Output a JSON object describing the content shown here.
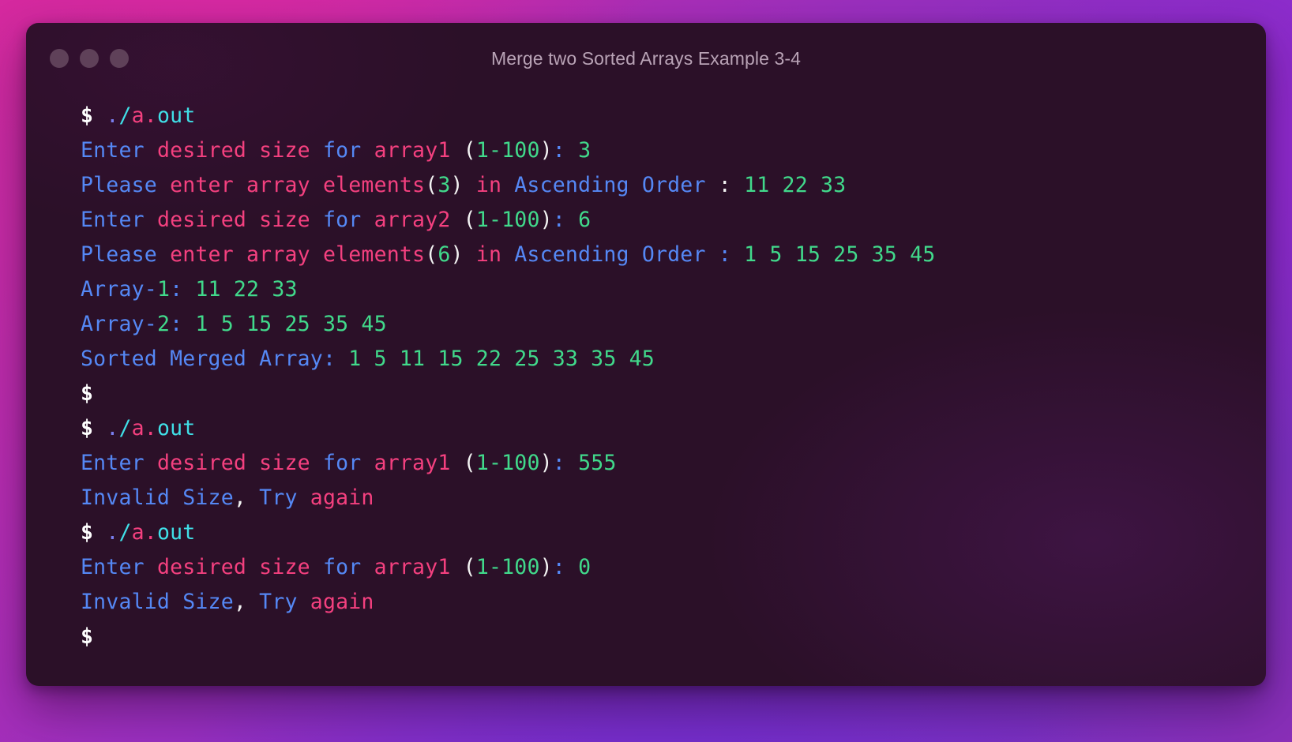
{
  "window": {
    "title": "Merge two Sorted Arrays Example 3-4",
    "dots": [
      "close-dot",
      "minimize-dot",
      "maximize-dot"
    ],
    "dot_color": "#5f4159",
    "background_color": "#2b1028"
  },
  "palette": {
    "prompt_white": "#ffffff",
    "pink": "#f4407f",
    "cyan": "#40e0e8",
    "blue": "#5588f5",
    "green": "#41d98b",
    "dot_purple": "#7a7ff0",
    "title_gray": "#b9a3b6",
    "desktop_gradient_from": "#d02a9e",
    "desktop_gradient_to": "#7c2fc6"
  },
  "terminal": {
    "prompt_symbol": "$",
    "command": "./a.out",
    "lines": [
      {
        "id": "line-1-command-1",
        "type": "command",
        "segments": [
          {
            "text": "$",
            "color": "prompt"
          },
          {
            "text": " ",
            "color": "white"
          },
          {
            "text": ".",
            "color": "dot"
          },
          {
            "text": "/",
            "color": "cyan"
          },
          {
            "text": "a",
            "color": "pink"
          },
          {
            "text": ".",
            "color": "pink"
          },
          {
            "text": "out",
            "color": "cyan"
          }
        ]
      },
      {
        "id": "line-2-prompt-size-array1",
        "type": "output",
        "segments": [
          {
            "text": "Enter",
            "color": "blue"
          },
          {
            "text": " ",
            "color": "white"
          },
          {
            "text": "desired size",
            "color": "pink"
          },
          {
            "text": " ",
            "color": "white"
          },
          {
            "text": "for",
            "color": "blue"
          },
          {
            "text": " ",
            "color": "white"
          },
          {
            "text": "array1",
            "color": "pink"
          },
          {
            "text": " ",
            "color": "white"
          },
          {
            "text": "(",
            "color": "white"
          },
          {
            "text": "1-100",
            "color": "green"
          },
          {
            "text": ")",
            "color": "white"
          },
          {
            "text": ":",
            "color": "blue"
          },
          {
            "text": " ",
            "color": "white"
          },
          {
            "text": "3",
            "color": "green"
          }
        ]
      },
      {
        "id": "line-3-enter-elements-3",
        "type": "output",
        "segments": [
          {
            "text": "Please",
            "color": "blue"
          },
          {
            "text": " ",
            "color": "white"
          },
          {
            "text": "enter array elements",
            "color": "pink"
          },
          {
            "text": "(",
            "color": "white"
          },
          {
            "text": "3",
            "color": "green"
          },
          {
            "text": ")",
            "color": "white"
          },
          {
            "text": " ",
            "color": "white"
          },
          {
            "text": "in",
            "color": "pink"
          },
          {
            "text": " ",
            "color": "white"
          },
          {
            "text": "Ascending Order",
            "color": "blue"
          },
          {
            "text": " ",
            "color": "white"
          },
          {
            "text": ":",
            "color": "white"
          },
          {
            "text": " ",
            "color": "white"
          },
          {
            "text": "11 22 33",
            "color": "green"
          }
        ]
      },
      {
        "id": "line-4-prompt-size-array2",
        "type": "output",
        "segments": [
          {
            "text": "Enter",
            "color": "blue"
          },
          {
            "text": " ",
            "color": "white"
          },
          {
            "text": "desired size",
            "color": "pink"
          },
          {
            "text": " ",
            "color": "white"
          },
          {
            "text": "for",
            "color": "blue"
          },
          {
            "text": " ",
            "color": "white"
          },
          {
            "text": "array2",
            "color": "pink"
          },
          {
            "text": " ",
            "color": "white"
          },
          {
            "text": "(",
            "color": "white"
          },
          {
            "text": "1-100",
            "color": "green"
          },
          {
            "text": ")",
            "color": "white"
          },
          {
            "text": ":",
            "color": "blue"
          },
          {
            "text": " ",
            "color": "white"
          },
          {
            "text": "6",
            "color": "green"
          }
        ]
      },
      {
        "id": "line-5-enter-elements-6",
        "type": "output",
        "segments": [
          {
            "text": "Please",
            "color": "blue"
          },
          {
            "text": " ",
            "color": "white"
          },
          {
            "text": "enter array elements",
            "color": "pink"
          },
          {
            "text": "(",
            "color": "white"
          },
          {
            "text": "6",
            "color": "green"
          },
          {
            "text": ")",
            "color": "white"
          },
          {
            "text": " ",
            "color": "white"
          },
          {
            "text": "in",
            "color": "pink"
          },
          {
            "text": " ",
            "color": "white"
          },
          {
            "text": "Ascending Order",
            "color": "blue"
          },
          {
            "text": " ",
            "color": "white"
          },
          {
            "text": ":",
            "color": "blue"
          },
          {
            "text": " ",
            "color": "white"
          },
          {
            "text": "1 5 15 25 35 45",
            "color": "green"
          }
        ]
      },
      {
        "id": "line-6-array-1-result",
        "type": "output",
        "segments": [
          {
            "text": "Array-",
            "color": "blue"
          },
          {
            "text": "1",
            "color": "green"
          },
          {
            "text": ":",
            "color": "blue"
          },
          {
            "text": " ",
            "color": "white"
          },
          {
            "text": "11 22 33",
            "color": "green"
          }
        ]
      },
      {
        "id": "line-7-array-2-result",
        "type": "output",
        "segments": [
          {
            "text": "Array-",
            "color": "blue"
          },
          {
            "text": "2",
            "color": "green"
          },
          {
            "text": ":",
            "color": "blue"
          },
          {
            "text": " ",
            "color": "white"
          },
          {
            "text": "1 5 15 25 35 45",
            "color": "green"
          }
        ]
      },
      {
        "id": "line-8-sorted-merged-array",
        "type": "output",
        "segments": [
          {
            "text": "Sorted Merged Array",
            "color": "blue"
          },
          {
            "text": ":",
            "color": "blue"
          },
          {
            "text": " ",
            "color": "white"
          },
          {
            "text": "1 5 11 15 22 25 33 35 45",
            "color": "green"
          }
        ]
      },
      {
        "id": "line-9-bare-prompt",
        "type": "prompt",
        "segments": [
          {
            "text": "$",
            "color": "prompt"
          }
        ]
      },
      {
        "id": "line-10-command-2",
        "type": "command",
        "segments": [
          {
            "text": "$",
            "color": "prompt"
          },
          {
            "text": " ",
            "color": "white"
          },
          {
            "text": ".",
            "color": "dot"
          },
          {
            "text": "/",
            "color": "cyan"
          },
          {
            "text": "a",
            "color": "pink"
          },
          {
            "text": ".",
            "color": "pink"
          },
          {
            "text": "out",
            "color": "cyan"
          }
        ]
      },
      {
        "id": "line-11-prompt-size-555",
        "type": "output",
        "segments": [
          {
            "text": "Enter",
            "color": "blue"
          },
          {
            "text": " ",
            "color": "white"
          },
          {
            "text": "desired size",
            "color": "pink"
          },
          {
            "text": " ",
            "color": "white"
          },
          {
            "text": "for",
            "color": "blue"
          },
          {
            "text": " ",
            "color": "white"
          },
          {
            "text": "array1",
            "color": "pink"
          },
          {
            "text": " ",
            "color": "white"
          },
          {
            "text": "(",
            "color": "white"
          },
          {
            "text": "1-100",
            "color": "green"
          },
          {
            "text": ")",
            "color": "white"
          },
          {
            "text": ":",
            "color": "blue"
          },
          {
            "text": " ",
            "color": "white"
          },
          {
            "text": "555",
            "color": "green"
          }
        ]
      },
      {
        "id": "line-12-invalid-size-1",
        "type": "output",
        "segments": [
          {
            "text": "Invalid Size",
            "color": "blue"
          },
          {
            "text": ",",
            "color": "white"
          },
          {
            "text": " ",
            "color": "white"
          },
          {
            "text": "Try",
            "color": "blue"
          },
          {
            "text": " ",
            "color": "white"
          },
          {
            "text": "again",
            "color": "pink"
          }
        ]
      },
      {
        "id": "line-13-command-3",
        "type": "command",
        "segments": [
          {
            "text": "$",
            "color": "prompt"
          },
          {
            "text": " ",
            "color": "white"
          },
          {
            "text": ".",
            "color": "dot"
          },
          {
            "text": "/",
            "color": "cyan"
          },
          {
            "text": "a",
            "color": "pink"
          },
          {
            "text": ".",
            "color": "pink"
          },
          {
            "text": "out",
            "color": "cyan"
          }
        ]
      },
      {
        "id": "line-14-prompt-size-0",
        "type": "output",
        "segments": [
          {
            "text": "Enter",
            "color": "blue"
          },
          {
            "text": " ",
            "color": "white"
          },
          {
            "text": "desired size",
            "color": "pink"
          },
          {
            "text": " ",
            "color": "white"
          },
          {
            "text": "for",
            "color": "blue"
          },
          {
            "text": " ",
            "color": "white"
          },
          {
            "text": "array1",
            "color": "pink"
          },
          {
            "text": " ",
            "color": "white"
          },
          {
            "text": "(",
            "color": "white"
          },
          {
            "text": "1-100",
            "color": "green"
          },
          {
            "text": ")",
            "color": "white"
          },
          {
            "text": ":",
            "color": "blue"
          },
          {
            "text": " ",
            "color": "white"
          },
          {
            "text": "0",
            "color": "green"
          }
        ]
      },
      {
        "id": "line-15-invalid-size-2",
        "type": "output",
        "segments": [
          {
            "text": "Invalid Size",
            "color": "blue"
          },
          {
            "text": ",",
            "color": "white"
          },
          {
            "text": " ",
            "color": "white"
          },
          {
            "text": "Try",
            "color": "blue"
          },
          {
            "text": " ",
            "color": "white"
          },
          {
            "text": "again",
            "color": "pink"
          }
        ]
      },
      {
        "id": "line-16-bare-prompt",
        "type": "prompt",
        "segments": [
          {
            "text": "$",
            "color": "prompt"
          }
        ]
      }
    ]
  }
}
